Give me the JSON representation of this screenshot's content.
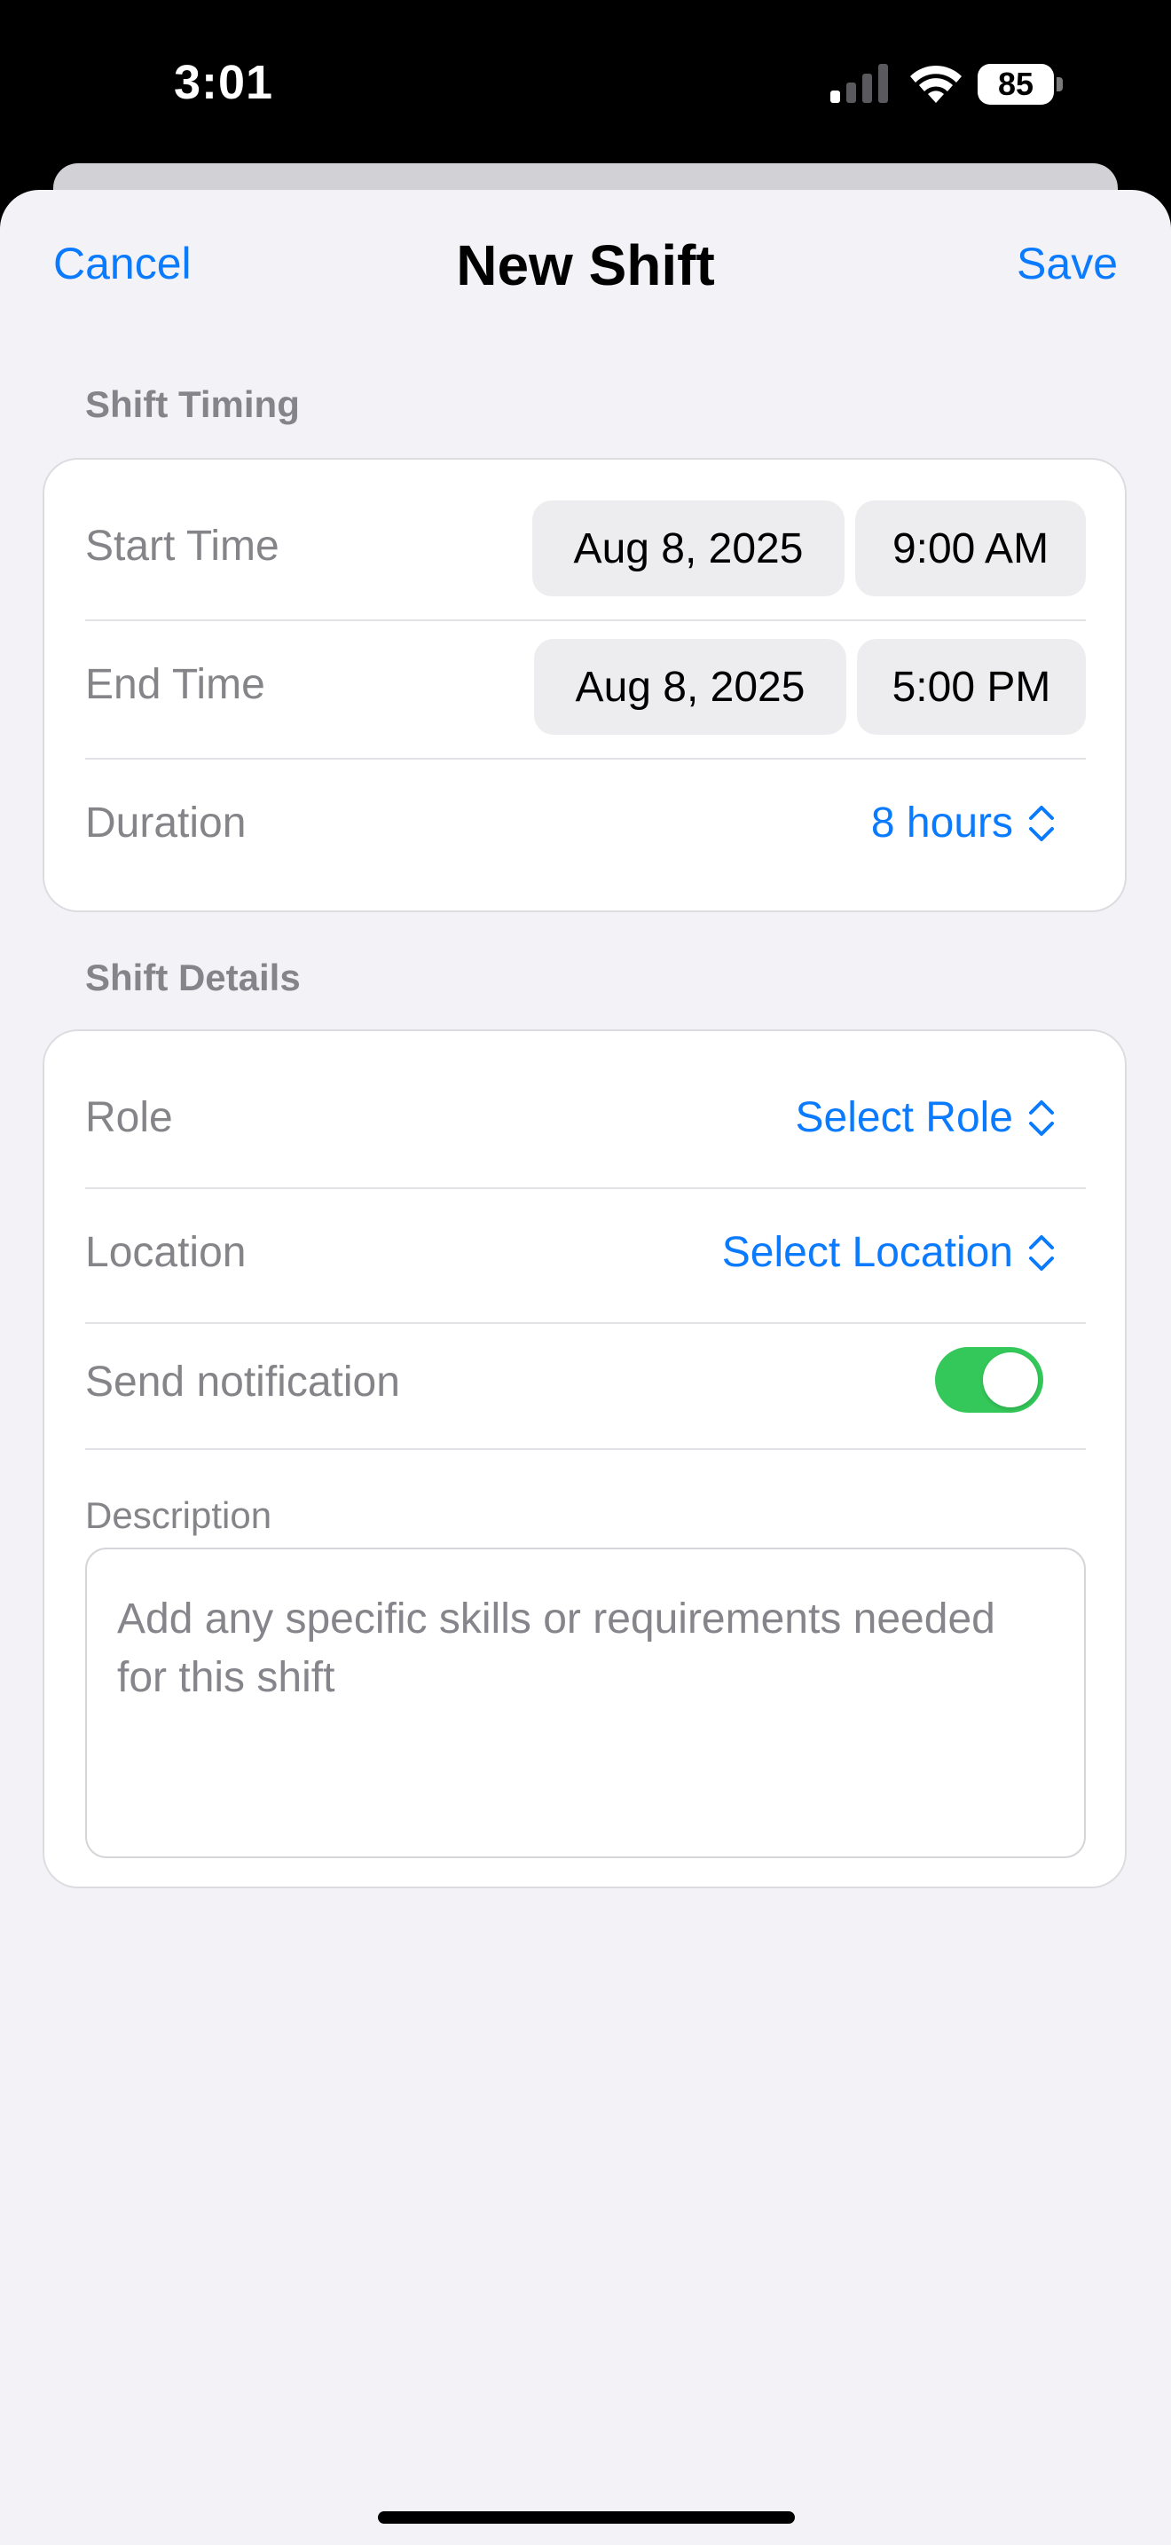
{
  "status_bar": {
    "time": "3:01",
    "battery": "85"
  },
  "nav": {
    "cancel": "Cancel",
    "title": "New Shift",
    "save": "Save"
  },
  "shift_timing": {
    "header": "Shift Timing",
    "start_label": "Start Time",
    "start_date": "Aug 8, 2025",
    "start_time": "9:00 AM",
    "end_label": "End Time",
    "end_date": "Aug 8, 2025",
    "end_time": "5:00 PM",
    "duration_label": "Duration",
    "duration_value": "8 hours"
  },
  "shift_details": {
    "header": "Shift Details",
    "role_label": "Role",
    "role_value": "Select Role",
    "location_label": "Location",
    "location_value": "Select Location",
    "notification_label": "Send notification",
    "notification_on": true,
    "description_label": "Description",
    "description_placeholder": "Add any specific skills or requirements needed for this shift"
  },
  "colors": {
    "accent": "#0a7aff",
    "toggle_on": "#34c759",
    "background": "#f2f2f7"
  }
}
